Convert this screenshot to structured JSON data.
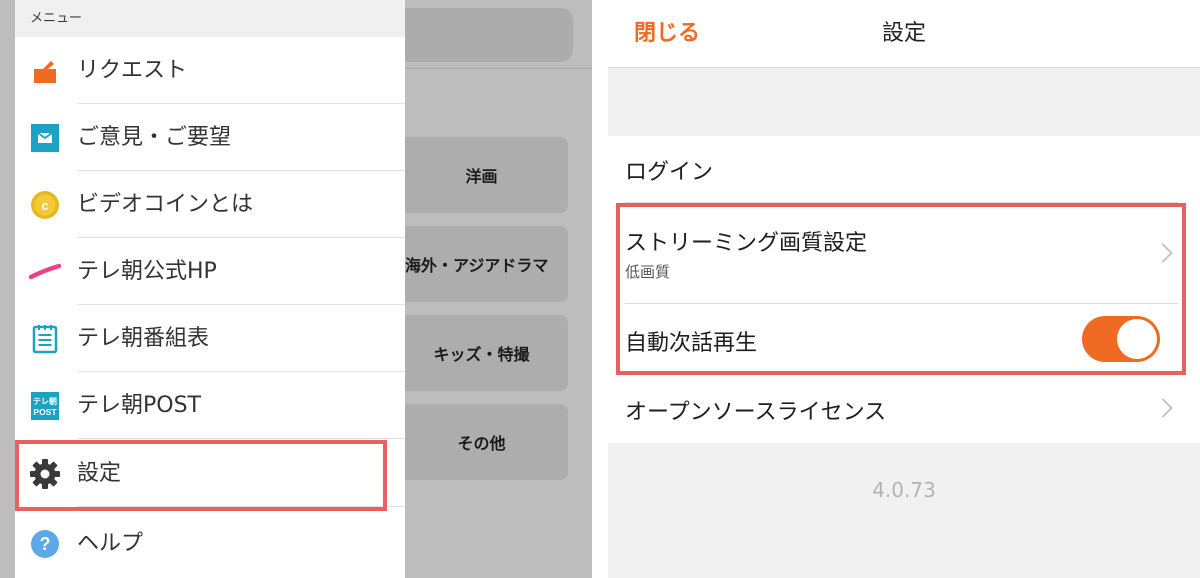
{
  "menu": {
    "header": "メニュー",
    "items": [
      {
        "label": "リクエスト",
        "icon": "request-icon"
      },
      {
        "label": "ご意見・ご要望",
        "icon": "mail-icon"
      },
      {
        "label": "ビデオコインとは",
        "icon": "coin-icon",
        "icon_text": "c"
      },
      {
        "label": "テレ朝公式HP",
        "icon": "tv-asahi-logo-icon"
      },
      {
        "label": "テレ朝番組表",
        "icon": "schedule-icon"
      },
      {
        "label": "テレ朝POST",
        "icon": "post-icon",
        "icon_text_1": "テレ朝",
        "icon_text_2": "POST"
      },
      {
        "label": "設定",
        "icon": "gear-icon"
      },
      {
        "label": "ヘルプ",
        "icon": "help-icon",
        "icon_text": "?"
      }
    ]
  },
  "background": {
    "categories": [
      "洋画",
      "海外・アジアドラマ",
      "キッズ・特撮",
      "その他"
    ]
  },
  "settings": {
    "close_label": "閉じる",
    "title": "設定",
    "rows": [
      {
        "title": "ログイン"
      },
      {
        "title": "ストリーミング画質設定",
        "subtitle": "低画質"
      },
      {
        "title": "自動次話再生",
        "toggle_on": true
      },
      {
        "title": "オープンソースライセンス"
      }
    ],
    "version": "4.0.73"
  },
  "colors": {
    "accent": "#ef6a23",
    "highlight": "#e86060",
    "teal": "#1aa3c2",
    "coin": "#e8b820",
    "pink": "#ee3f8a",
    "help": "#5ca8e8"
  }
}
